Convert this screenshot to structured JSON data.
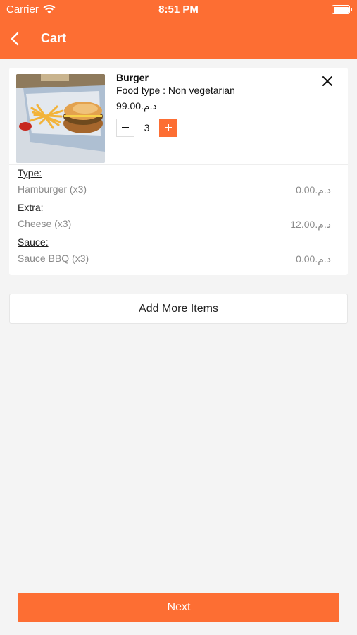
{
  "status_bar": {
    "carrier": "Carrier",
    "time": "8:51 PM"
  },
  "header": {
    "title": "Cart"
  },
  "cart_item": {
    "name": "Burger",
    "food_type": "Food type : Non vegetarian",
    "price": "د.م.99.00",
    "quantity": "3",
    "image_icon": "burger-photo"
  },
  "options": [
    {
      "heading": "Type:",
      "name": "Hamburger (x3)",
      "price": "د.م.0.00"
    },
    {
      "heading": "Extra:",
      "name": "Cheese (x3)",
      "price": "د.م.12.00"
    },
    {
      "heading": "Sauce:",
      "name": "Sauce BBQ (x3)",
      "price": "د.م.0.00"
    }
  ],
  "actions": {
    "add_more": "Add More Items",
    "next": "Next"
  },
  "colors": {
    "accent": "#fd6e33",
    "background": "#f4f4f4"
  }
}
